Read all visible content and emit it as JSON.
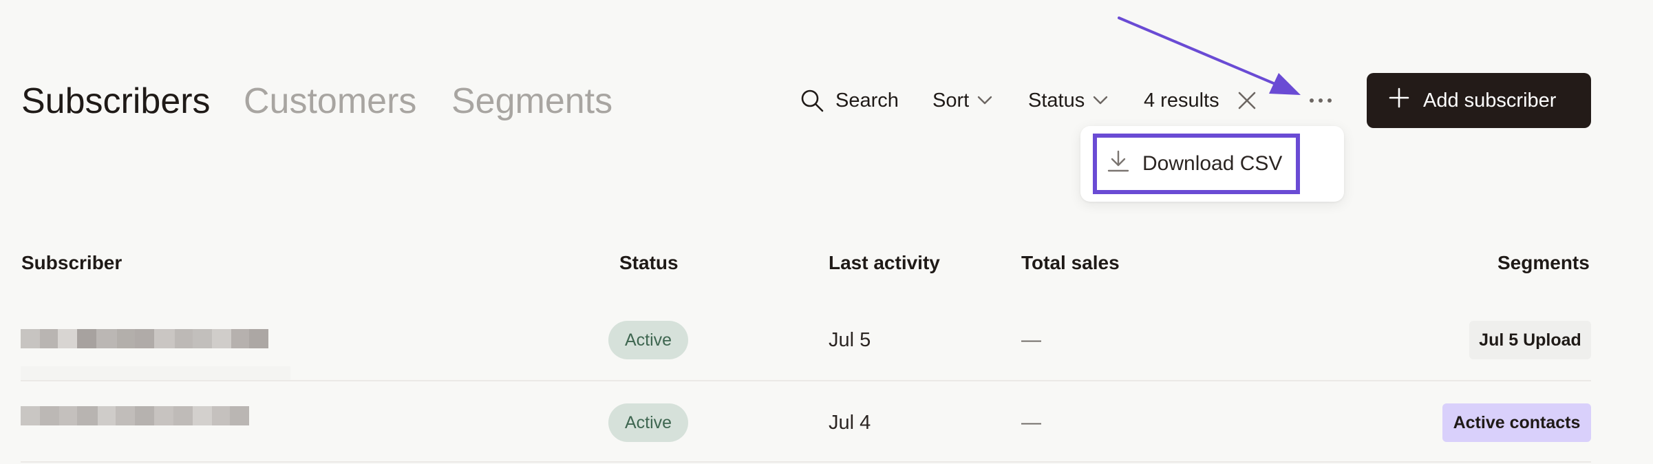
{
  "tabs": [
    {
      "label": "Subscribers",
      "active": true
    },
    {
      "label": "Customers",
      "active": false
    },
    {
      "label": "Segments",
      "active": false
    }
  ],
  "toolbar": {
    "search_label": "Search",
    "sort_label": "Sort",
    "status_label": "Status",
    "results_label": "4 results",
    "add_label": "Add subscriber"
  },
  "menu": {
    "download_label": "Download CSV"
  },
  "table": {
    "headers": {
      "subscriber": "Subscriber",
      "status": "Status",
      "last_activity": "Last activity",
      "total_sales": "Total sales",
      "segments": "Segments"
    },
    "rows": [
      {
        "status": "Active",
        "last_activity": "Jul 5",
        "total_sales": "—",
        "segment": "Jul 5 Upload"
      },
      {
        "status": "Active",
        "last_activity": "Jul 4",
        "total_sales": "—",
        "segment": "Active contacts"
      }
    ]
  },
  "colors": {
    "background": "#f8f8f6",
    "primary_button": "#231b18",
    "highlight": "#6a4bd4",
    "active_badge_bg": "#d6e1da",
    "active_badge_text": "#3e6650",
    "segment_default_bg": "#efefed",
    "segment_purple_bg": "#d9d0fb",
    "annotation_arrow": "#6a4bd4"
  },
  "icons": [
    "search-icon",
    "chevron-down-icon",
    "close-icon",
    "more-horizontal-icon",
    "plus-icon",
    "download-icon"
  ]
}
